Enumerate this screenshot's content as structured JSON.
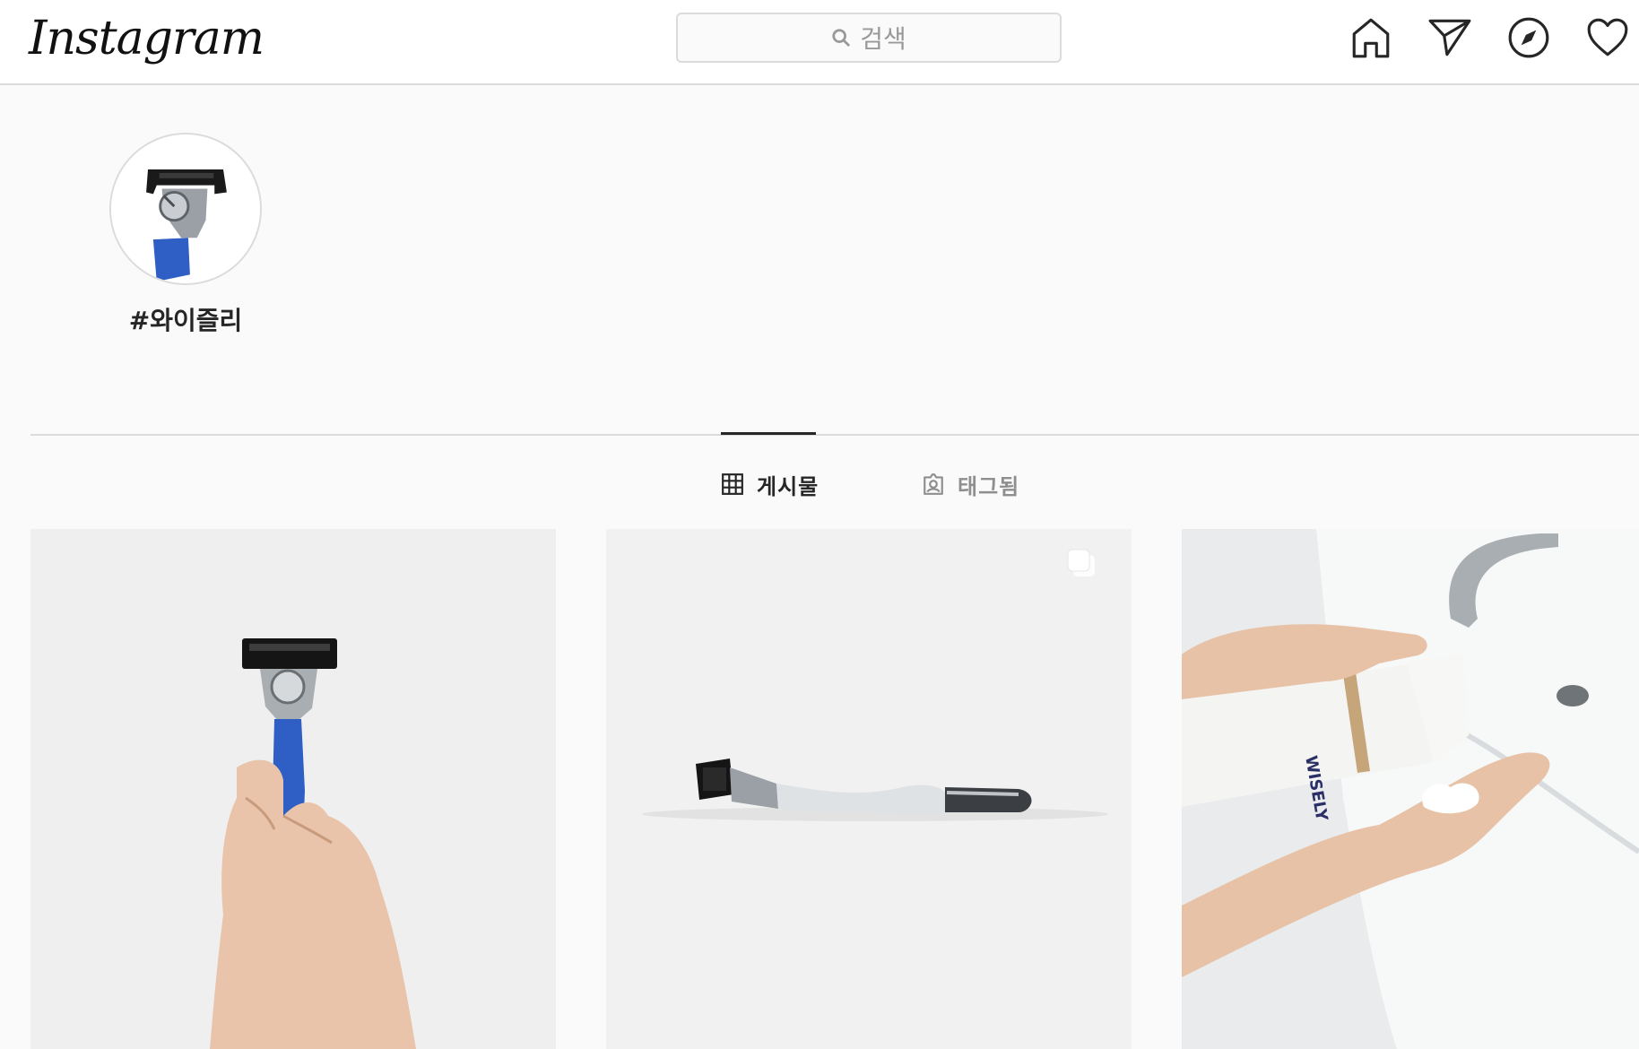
{
  "app": {
    "logo_text": "Instagram"
  },
  "search": {
    "placeholder": "검색",
    "icon": "search-icon"
  },
  "nav": {
    "icons": [
      "home-icon",
      "direct-message-icon",
      "explore-icon",
      "activity-heart-icon"
    ]
  },
  "hashtag": {
    "name": "#와이즐리"
  },
  "tabs": [
    {
      "label": "게시물",
      "icon": "grid-icon",
      "active": true
    },
    {
      "label": "태그됨",
      "icon": "tagged-icon",
      "active": false
    }
  ],
  "posts": [
    {
      "description": "hand-holding-blue-razor",
      "multi": false
    },
    {
      "description": "white-razor-lying",
      "multi": true
    },
    {
      "description": "shaving-gel-dispensed-into-hand",
      "multi": false
    }
  ],
  "colors": {
    "accent_blue": "#2f5fc4",
    "border": "#dbdbdb",
    "text_primary": "#262626",
    "text_secondary": "#8e8e8e"
  }
}
